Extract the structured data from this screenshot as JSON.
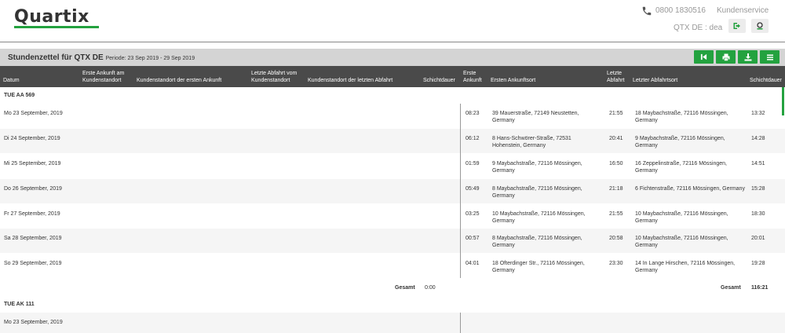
{
  "brand": {
    "logo_text": "Quartix",
    "accent_color": "#23a23f"
  },
  "header": {
    "phone": "0800 1830516",
    "support_label": "Kundenservice",
    "user": "QTX DE : dea",
    "icons": [
      "phone-icon",
      "logout-icon",
      "support-icon"
    ]
  },
  "titlebar": {
    "title": "Stundenzettel für QTX DE",
    "period": "Periode: 23 Sep 2019 - 29 Sep 2019",
    "buttons": [
      "first-page-icon",
      "print-icon",
      "download-icon",
      "menu-icon"
    ]
  },
  "columns": {
    "datum": "Datum",
    "erste_ankunft_kunde": "Erste Ankunft am Kundenstandort",
    "kunde_erste_ankunft": "Kundenstandort der ersten Ankunft",
    "letzte_abfahrt_kunde": "Letzte Abfahrt vom Kundenstandort",
    "kunde_letzte_abfahrt": "Kundenstandort der letzten Abfahrt",
    "schichtdauer1": "Schichtdauer",
    "erste_ankunft": "Erste Ankunft",
    "ersten_ankunftsort": "Ersten Ankunftsort",
    "letzte_abfahrt": "Letzte Abfahrt",
    "letzter_abfahrtsort": "Letzter Abfahrtsort",
    "schichtdauer2": "Schichtdauer"
  },
  "groups": [
    {
      "vehicle": "TUE AA 569",
      "rows": [
        {
          "date": "Mo 23 September, 2019",
          "first_arrival": "08:23",
          "first_place": "39 Mauerstraße, 72149 Neustetten, Germany",
          "last_departure": "21:55",
          "last_place": "18 Maybachstraße, 72116 Mössingen, Germany",
          "duration": "13:32"
        },
        {
          "date": "Di 24 September, 2019",
          "first_arrival": "06:12",
          "first_place": "8 Hans-Schwörer-Straße, 72531 Hohenstein, Germany",
          "last_departure": "20:41",
          "last_place": "9 Maybachstraße, 72116 Mössingen, Germany",
          "duration": "14:28"
        },
        {
          "date": "Mi 25 September, 2019",
          "first_arrival": "01:59",
          "first_place": "9 Maybachstraße, 72116 Mössingen, Germany",
          "last_departure": "16:50",
          "last_place": "16 Zeppelinstraße, 72116 Mössingen, Germany",
          "duration": "14:51"
        },
        {
          "date": "Do 26 September, 2019",
          "first_arrival": "05:49",
          "first_place": "8 Maybachstraße, 72116 Mössingen, Germany",
          "last_departure": "21:18",
          "last_place": "6 Fichtenstraße, 72116 Mössingen, Germany",
          "duration": "15:28"
        },
        {
          "date": "Fr 27 September, 2019",
          "first_arrival": "03:25",
          "first_place": "10 Maybachstraße, 72116 Mössingen, Germany",
          "last_departure": "21:55",
          "last_place": "10 Maybachstraße, 72116 Mössingen, Germany",
          "duration": "18:30"
        },
        {
          "date": "Sa 28 September, 2019",
          "first_arrival": "00:57",
          "first_place": "8 Maybachstraße, 72116 Mössingen, Germany",
          "last_departure": "20:58",
          "last_place": "10 Maybachstraße, 72116 Mössingen, Germany",
          "duration": "20:01"
        },
        {
          "date": "So 29 September, 2019",
          "first_arrival": "04:01",
          "first_place": "18 Ofterdinger Str., 72116 Mössingen, Germany",
          "last_departure": "23:30",
          "last_place": "14 In Lange Hirschen, 72116 Mössingen, Germany",
          "duration": "19:28"
        }
      ],
      "total_label_left": "Gesamt",
      "total_left": "0:00",
      "total_label_right": "Gesamt",
      "total_right": "116:21"
    },
    {
      "vehicle": "TUE AK 111",
      "rows": [
        {
          "date": "Mo 23 September, 2019"
        }
      ]
    }
  ]
}
